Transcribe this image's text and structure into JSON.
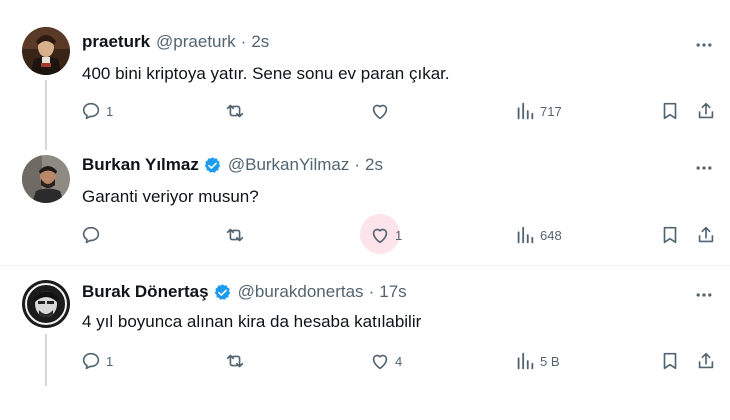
{
  "tweets": [
    {
      "name": "praeturk",
      "handle": "@praeturk",
      "time": "2s",
      "text": "400 bini kriptoya yatır. Sene sonu ev paran çıkar.",
      "replies": "1",
      "retweets": "",
      "likes": "",
      "views": "717",
      "verified": false
    },
    {
      "name": "Burkan Yılmaz",
      "handle": "@BurkanYilmaz",
      "time": "2s",
      "text": "Garanti veriyor musun?",
      "replies": "",
      "retweets": "",
      "likes": "1",
      "views": "648",
      "verified": true
    },
    {
      "name": "Burak Dönertaş",
      "handle": "@burakdonertas",
      "time": "17s",
      "text": "4 yıl boyunca alınan kira da hesaba katılabilir",
      "replies": "1",
      "retweets": "",
      "likes": "4",
      "views": "5 B",
      "verified": true
    }
  ],
  "separator": "·",
  "icons": {
    "reply": "reply-icon",
    "retweet": "retweet-icon",
    "like": "heart-icon",
    "views": "views-icon",
    "bookmark": "bookmark-icon",
    "share": "share-icon",
    "more": "more-icon",
    "verified": "verified-badge-icon"
  },
  "colors": {
    "text": "#0f1419",
    "secondary": "#536471",
    "verified": "#1d9bf0",
    "like_highlight": "#fde4ea",
    "thread_line": "#cfd9de"
  }
}
